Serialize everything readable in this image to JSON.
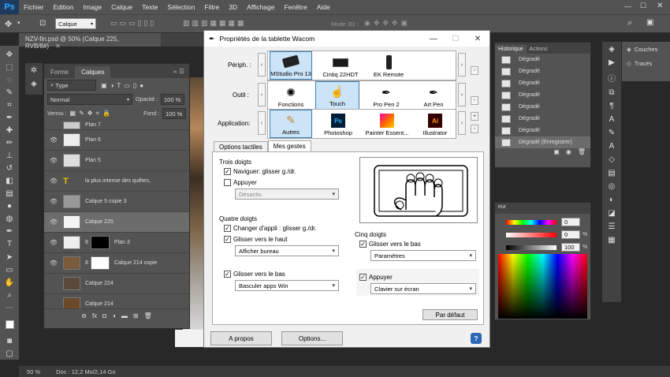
{
  "app": {
    "logo": "Ps"
  },
  "menu": [
    "Fichier",
    "Edition",
    "Image",
    "Calque",
    "Texte",
    "Sélection",
    "Filtre",
    "3D",
    "Affichage",
    "Fenêtre",
    "Aide"
  ],
  "options": {
    "tool_select": "Calque",
    "mode3d_label": "Mode 3D :"
  },
  "document_tab": {
    "title": "NZV-fin.psd @ 50% (Calque 225, RVB/8#)"
  },
  "layers_panel": {
    "tabs": [
      "Forme",
      "Calques"
    ],
    "filter_label": "Type",
    "blend_mode": "Normal",
    "opacity_label": "Opacité :",
    "opacity_value": "100 %",
    "lock_label": "Verrou :",
    "fill_label": "Fond :",
    "fill_value": "100 %",
    "layers": [
      {
        "name": "Plan 7"
      },
      {
        "name": "Plan 6"
      },
      {
        "name": "Plan 5"
      },
      {
        "name": "la plus intense  des quêtes,"
      },
      {
        "name": "Calque 5 copie 3"
      },
      {
        "name": "Calque 225"
      },
      {
        "name": "Plan 3"
      },
      {
        "name": "Calque 214 copie"
      },
      {
        "name": "Calque 224"
      },
      {
        "name": "Calque 214"
      }
    ]
  },
  "status": {
    "zoom": "50 %",
    "doc": "Doc : 12,2 Mo/2,14 Go"
  },
  "history_panel": {
    "tabs": [
      "Historique",
      "Actions"
    ],
    "items": [
      "Dégradé",
      "Dégradé",
      "Dégradé",
      "Dégradé",
      "Dégradé",
      "Dégradé",
      "Dégradé",
      "Dégradé (Enregistrer)"
    ]
  },
  "color_panel": {
    "title": "eur",
    "values": [
      "0",
      "0",
      "100"
    ],
    "units": [
      "",
      "%",
      "%"
    ]
  },
  "right_panels": {
    "items": [
      "Couches",
      "Tracés"
    ]
  },
  "dialog": {
    "title": "Propriétés de la tablette Wacom",
    "peripheral_label": "Périph. :",
    "peripherals": [
      "MStudio Pro 13",
      "Cintiq 22HDT",
      "EK Remote"
    ],
    "tool_label": "Outil :",
    "tools": [
      "Fonctions",
      "Touch",
      "Pro Pen 2",
      "Art Pen"
    ],
    "application_label": "Application:",
    "applications": [
      "Autres",
      "Photoshop",
      "Painter Essent...",
      "Illustrator"
    ],
    "tabs": [
      "Options tactiles",
      "Mes gestes"
    ],
    "three_fingers": {
      "title": "Trois doigts",
      "navigate": "Naviguer: glisser g./dr.",
      "press": "Appuyer",
      "press_action": "Désactiv."
    },
    "four_fingers": {
      "title": "Quatre doigts",
      "switch_app": "Changer d'appli : glisser g./dr.",
      "swipe_up": "Glisser vers le haut",
      "swipe_up_action": "Afficher bureau",
      "swipe_down": "Glisser vers le bas",
      "swipe_down_action": "Basculer apps Win"
    },
    "five_fingers": {
      "title": "Cinq doigts",
      "swipe_down": "Glisser vers le bas",
      "swipe_down_action": "Paramètres",
      "press": "Appuyer",
      "press_action": "Clavier sur écran"
    },
    "default_button": "Par défaut",
    "about_button": "A propos",
    "options_button": "Options...",
    "help_glyph": "?"
  }
}
